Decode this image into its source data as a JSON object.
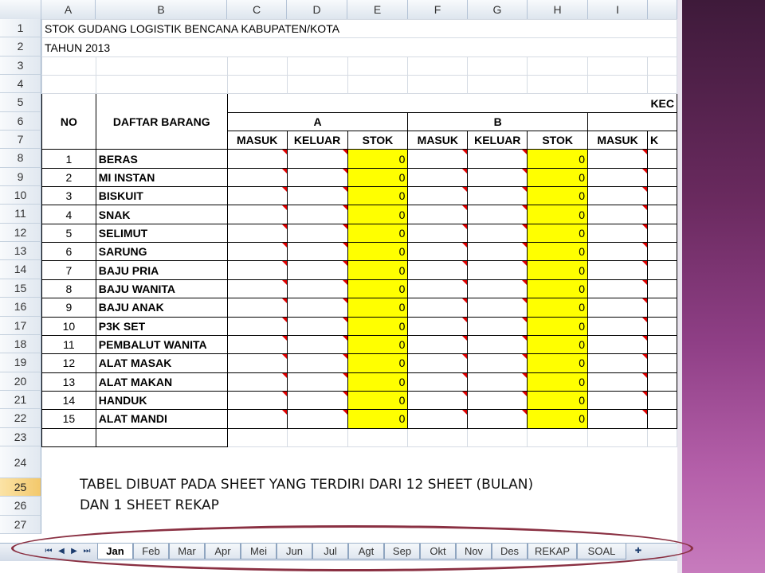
{
  "columns": [
    "A",
    "B",
    "C",
    "D",
    "E",
    "F",
    "G",
    "H",
    "I"
  ],
  "rows": [
    "1",
    "2",
    "3",
    "4",
    "5",
    "6",
    "7",
    "8",
    "9",
    "10",
    "11",
    "12",
    "13",
    "14",
    "15",
    "16",
    "17",
    "18",
    "19",
    "20",
    "21",
    "22",
    "23",
    "24",
    "25",
    "26",
    "27"
  ],
  "title1": "STOK GUDANG LOGISTIK BENCANA KABUPATEN/KOTA",
  "title2": "TAHUN 2013",
  "header": {
    "no": "NO",
    "daftar": "DAFTAR BARANG",
    "kec": "KEC",
    "group_a": "A",
    "group_b": "B",
    "masuk": "MASUK",
    "keluar": "KELUAR",
    "stok": "STOK",
    "k_partial": "K"
  },
  "items": [
    {
      "no": "1",
      "name": "BERAS",
      "stok_a": "0",
      "stok_b": "0"
    },
    {
      "no": "2",
      "name": "MI INSTAN",
      "stok_a": "0",
      "stok_b": "0"
    },
    {
      "no": "3",
      "name": "BISKUIT",
      "stok_a": "0",
      "stok_b": "0"
    },
    {
      "no": "4",
      "name": "SNAK",
      "stok_a": "0",
      "stok_b": "0"
    },
    {
      "no": "5",
      "name": "SELIMUT",
      "stok_a": "0",
      "stok_b": "0"
    },
    {
      "no": "6",
      "name": "SARUNG",
      "stok_a": "0",
      "stok_b": "0"
    },
    {
      "no": "7",
      "name": "BAJU PRIA",
      "stok_a": "0",
      "stok_b": "0"
    },
    {
      "no": "8",
      "name": "BAJU WANITA",
      "stok_a": "0",
      "stok_b": "0"
    },
    {
      "no": "9",
      "name": "BAJU ANAK",
      "stok_a": "0",
      "stok_b": "0"
    },
    {
      "no": "10",
      "name": "P3K SET",
      "stok_a": "0",
      "stok_b": "0"
    },
    {
      "no": "11",
      "name": "PEMBALUT WANITA",
      "stok_a": "0",
      "stok_b": "0"
    },
    {
      "no": "12",
      "name": "ALAT MASAK",
      "stok_a": "0",
      "stok_b": "0"
    },
    {
      "no": "13",
      "name": "ALAT MAKAN",
      "stok_a": "0",
      "stok_b": "0"
    },
    {
      "no": "14",
      "name": "HANDUK",
      "stok_a": "0",
      "stok_b": "0"
    },
    {
      "no": "15",
      "name": "ALAT MANDI",
      "stok_a": "0",
      "stok_b": "0"
    }
  ],
  "caption_line1": "TABEL DIBUAT PADA SHEET YANG TERDIRI DARI 12 SHEET (BULAN)",
  "caption_line2": "DAN 1 SHEET REKAP",
  "tabs": [
    "Jan",
    "Feb",
    "Mar",
    "Apr",
    "Mei",
    "Jun",
    "Jul",
    "Agt",
    "Sep",
    "Okt",
    "Nov",
    "Des",
    "REKAP",
    "SOAL"
  ],
  "active_tab": "Jan",
  "colors": {
    "stok_fill": "#ffff00",
    "comment_marker": "#e00000",
    "oval": "#8a3042",
    "deco": "#6a2a5f"
  }
}
